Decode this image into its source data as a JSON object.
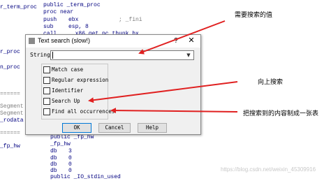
{
  "code_lines": {
    "l0": "r_term_proc",
    "l0b": "public _term_proc",
    "l1": "proc near",
    "l2a": "push",
    "l2b": "ebx",
    "l2c": "; _fini",
    "l3a": "sub",
    "l3b": "esp, 8",
    "l4a": "call",
    "l4b": "__x86_get_pc_thunk_bx",
    "left_proc1": "r_proc",
    "left_proc2": "n_proc",
    "left_eq1": "======",
    "left_eq2": "======",
    "left_seg1": "Segment",
    "left_seg2": "Segment",
    "left_rodata": "_rodata",
    "left_fp": "_fp_hw",
    "bottom_public": "public _fp_hw",
    "bottom_fp": "_fp_hw",
    "db1": "db",
    "db1v": "3",
    "db2": "db",
    "db2v": "0",
    "db3": "db",
    "db3v": "0",
    "db4": "db",
    "db4v": "0",
    "last": "public _IO_stdin_used"
  },
  "dialog": {
    "title": "Text search (slow!)",
    "help_glyph": "?",
    "close_glyph": "✕",
    "string_label": "String",
    "string_value": "",
    "options": [
      {
        "label": "Match case",
        "checked": false
      },
      {
        "label": "Regular expression",
        "checked": false
      },
      {
        "label": "Identifier",
        "checked": false
      },
      {
        "label": "Search Up",
        "checked": false
      },
      {
        "label": "Find all occurrences",
        "checked": false
      }
    ],
    "buttons": {
      "ok": "OK",
      "cancel": "Cancel",
      "help": "Help"
    }
  },
  "callouts": {
    "search_value": "需要搜索的值",
    "search_up": "向上搜索",
    "find_all": "把搜索到的内容制成一张表"
  },
  "watermark": "https://blog.csdn.net/weixin_45309916",
  "colors": {
    "arrow": "#e02020",
    "code": "#000080",
    "dialog_bg": "#f0f0f0"
  }
}
